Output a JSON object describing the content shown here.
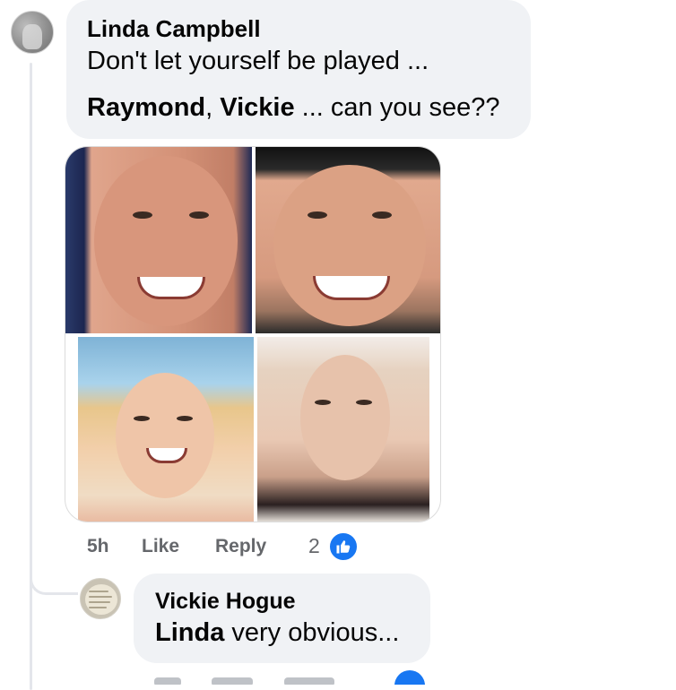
{
  "comment": {
    "author": "Linda Campbell",
    "line1": "Don't let yourself be played ...",
    "mention1": "Raymond",
    "sep": ",",
    "mention2": "Vickie",
    "line2_rest": " ... can you see??",
    "time": "5h",
    "like_label": "Like",
    "reply_label": "Reply",
    "reaction_count": "2",
    "reaction_icon": "thumbs-up-icon",
    "avatar_icon": "avatar-photo"
  },
  "reply": {
    "author": "Vickie Hogue",
    "mention": "Linda",
    "text_rest": " very obvious...",
    "avatar_icon": "avatar-text-photo"
  },
  "colors": {
    "bubble_bg": "#f0f2f5",
    "meta_text": "#65676b",
    "like_blue": "#1877f2",
    "thread_line": "#e4e6eb"
  }
}
